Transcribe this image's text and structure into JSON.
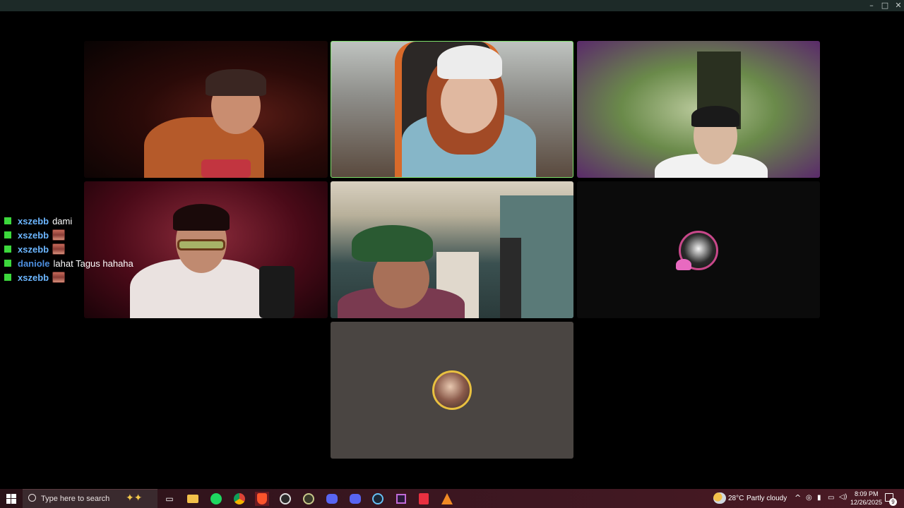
{
  "window": {
    "controls": {
      "minimize": "–",
      "maximize": "□",
      "close": "✕"
    }
  },
  "call": {
    "tiles": [
      {
        "id": "p1",
        "name": "participant-cap-orange",
        "video": true,
        "active_speaker": false
      },
      {
        "id": "p2",
        "name": "participant-white-cap-glasses",
        "video": true,
        "active_speaker": true
      },
      {
        "id": "p3",
        "name": "participant-green-blur",
        "video": true,
        "active_speaker": false
      },
      {
        "id": "p4",
        "name": "participant-glasses-red",
        "video": true,
        "active_speaker": false
      },
      {
        "id": "p5",
        "name": "participant-green-cap",
        "video": true,
        "active_speaker": false
      },
      {
        "id": "p6",
        "name": "participant-avatar-dark",
        "video": false,
        "active_speaker": false
      },
      {
        "id": "p7",
        "name": "participant-avatar-grey",
        "video": false,
        "active_speaker": false
      }
    ],
    "active_border_color": "#7ddf6a"
  },
  "chat": {
    "badge_color": "#3cd83c",
    "messages": [
      {
        "user": "xszebb",
        "user_color": "#6cb6ff",
        "text": "dami",
        "emote": false
      },
      {
        "user": "xszebb",
        "user_color": "#6cb6ff",
        "text": "",
        "emote": true
      },
      {
        "user": "xszebb",
        "user_color": "#6cb6ff",
        "text": "",
        "emote": true
      },
      {
        "user": "daniole",
        "user_color": "#4d8fe0",
        "text": "lahat Tagus hahaha",
        "emote": false
      },
      {
        "user": "xszebb",
        "user_color": "#6cb6ff",
        "text": "",
        "emote": true
      }
    ]
  },
  "taskbar": {
    "search_placeholder": "Type here to search",
    "apps": [
      "start-icon",
      "task-view-icon",
      "file-explorer-icon",
      "spotify-icon",
      "chrome-icon",
      "brave-icon",
      "obs-icon",
      "app-icon",
      "discord-ptb-icon",
      "discord-icon",
      "steam-icon",
      "vscode-icon",
      "brave-beta-icon",
      "vlc-icon"
    ],
    "weather_temp": "28°C",
    "weather_desc": "Partly cloudy",
    "time": "8:09 PM",
    "date": "12/26/2025",
    "notification_count": "9"
  }
}
